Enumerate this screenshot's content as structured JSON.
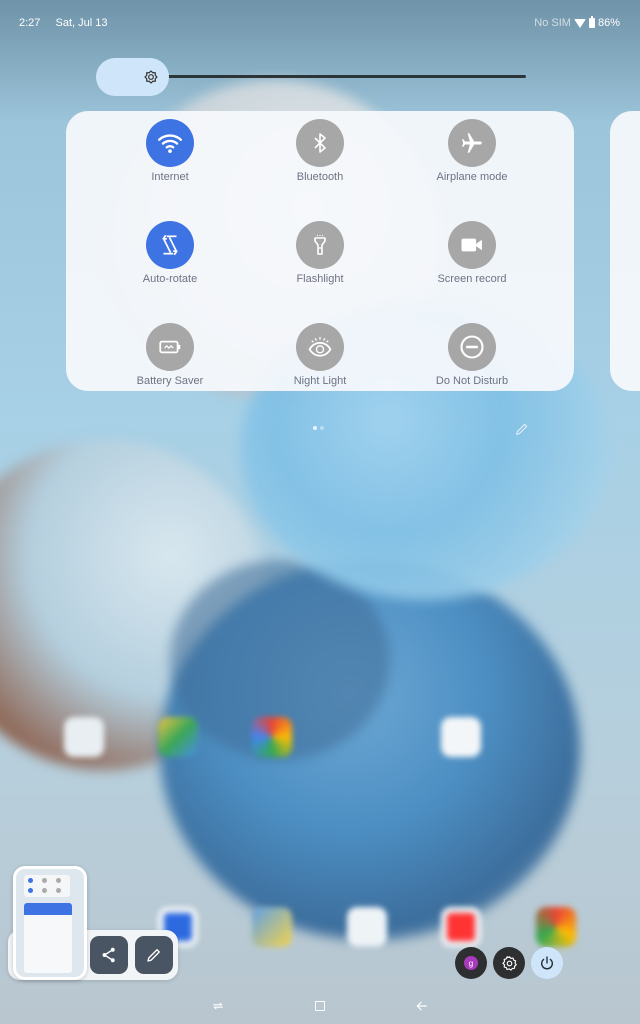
{
  "status_bar": {
    "time": "2:27",
    "date": "Sat, Jul 13",
    "sim": "No SIM",
    "wifi_icon": "wifi-icon",
    "battery_icon": "battery-icon",
    "battery": "86%"
  },
  "brightness": {
    "level": 0.15,
    "icon": "brightness-icon"
  },
  "quick_settings": {
    "tiles": [
      {
        "label": "Internet",
        "icon": "wifi-icon",
        "state": "on"
      },
      {
        "label": "Bluetooth",
        "icon": "bluetooth-icon",
        "state": "off"
      },
      {
        "label": "Airplane mode",
        "icon": "airplane-icon",
        "state": "off"
      },
      {
        "label": "Auto-rotate",
        "icon": "rotate-icon",
        "state": "on"
      },
      {
        "label": "Flashlight",
        "icon": "flashlight-icon",
        "state": "off"
      },
      {
        "label": "Screen record",
        "icon": "video-camera-icon",
        "state": "off"
      },
      {
        "label": "Battery Saver",
        "icon": "battery-saver-icon",
        "state": "off"
      },
      {
        "label": "Night Light",
        "icon": "eye-icon",
        "state": "off"
      },
      {
        "label": "Do Not Disturb",
        "icon": "do-not-disturb-icon",
        "state": "off"
      }
    ],
    "page_count": 2,
    "current_page": 1,
    "edit_icon": "pencil-icon"
  },
  "screenshot_preview": {
    "share_icon": "share-icon",
    "edit_icon": "pencil-icon"
  },
  "footer_buttons": {
    "user_badge": "g",
    "settings_icon": "gear-icon",
    "power_icon": "power-icon"
  },
  "nav_bar": {
    "recents_icon": "recents-icon",
    "home_icon": "home-icon",
    "back_icon": "back-arrow-icon"
  },
  "colors": {
    "accent": "#3d73e3",
    "tile_off": "#a7a7a7",
    "user_badge": "#a83bbd",
    "power_bg": "#cfe6fa"
  }
}
